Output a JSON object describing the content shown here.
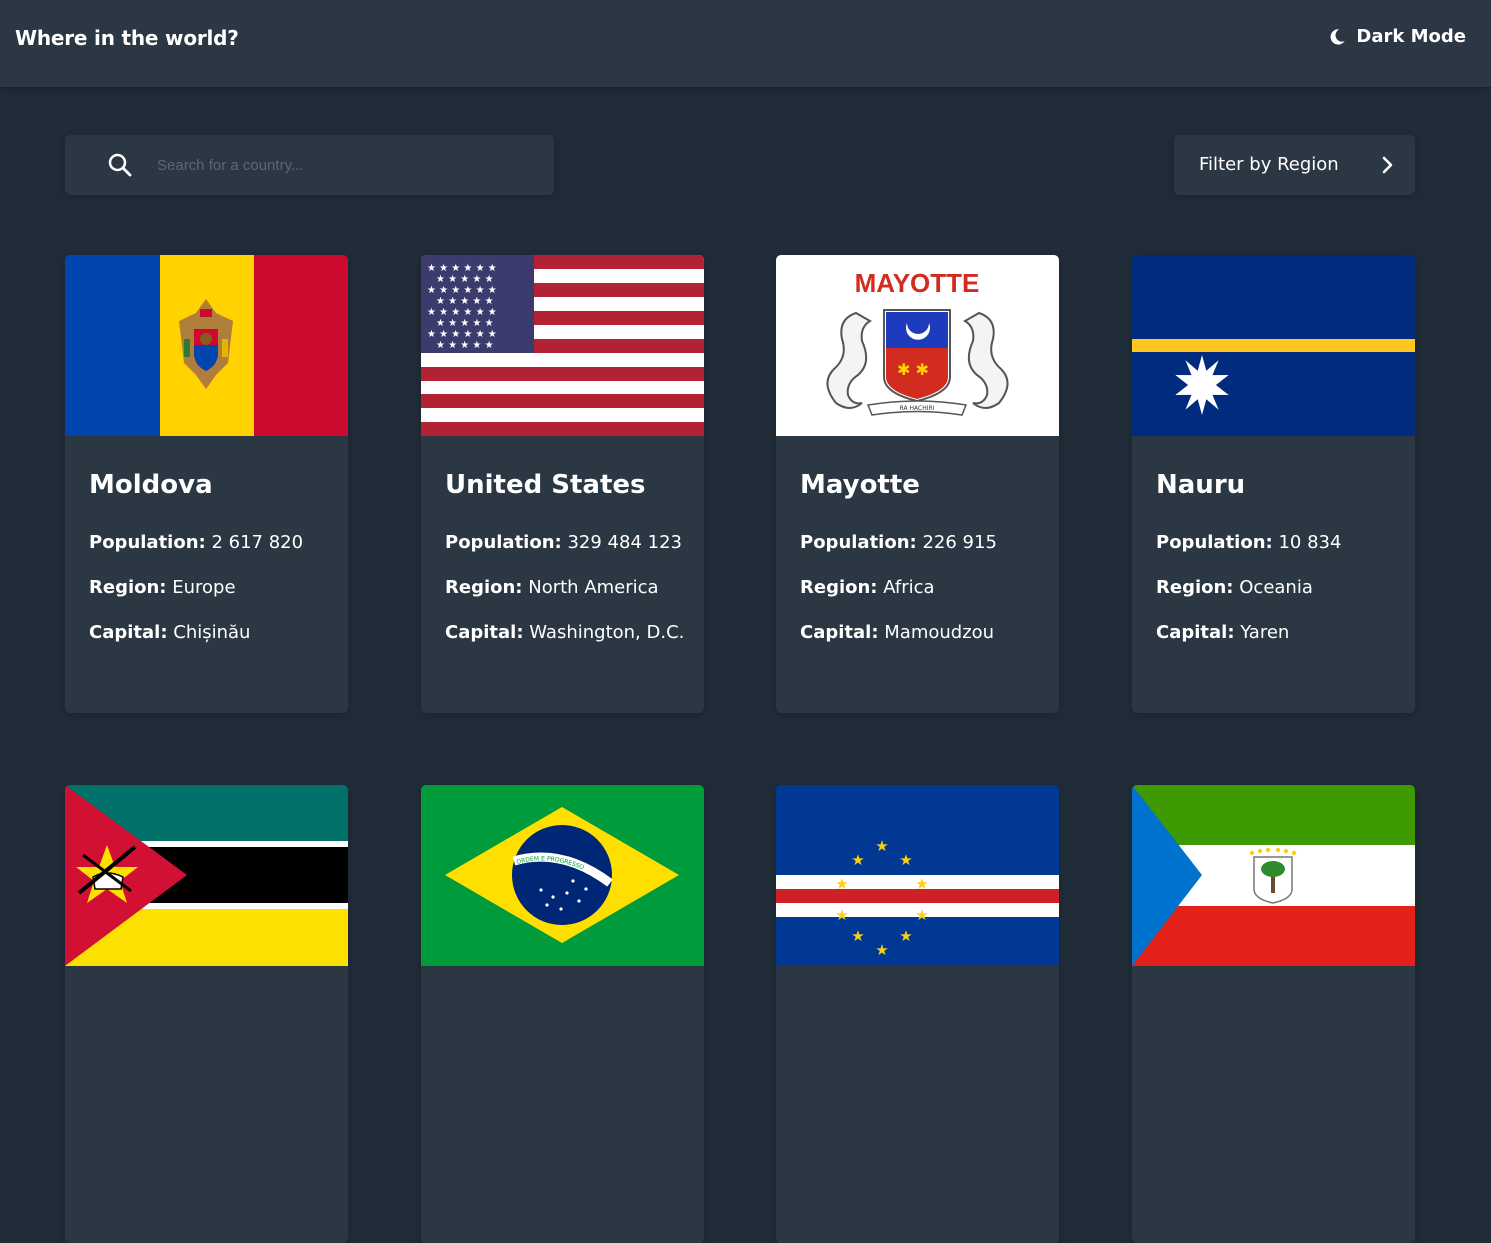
{
  "header": {
    "title": "Where in the world?",
    "theme_toggle_label": "Dark Mode"
  },
  "search": {
    "placeholder": "Search for a country...",
    "value": ""
  },
  "filter": {
    "label": "Filter by Region"
  },
  "labels": {
    "population": "Population:",
    "region": "Region:",
    "capital": "Capital:"
  },
  "flag_text": {
    "mayotte_title": "MAYOTTE",
    "mayotte_motto": "RA HACHIRI",
    "brazil_motto": "ORDEM E PROGRESSO"
  },
  "countries": [
    {
      "name": "Moldova",
      "population": "2 617 820",
      "region": "Europe",
      "capital": "Chișinău",
      "flag_icon": "moldova-flag"
    },
    {
      "name": "United States",
      "population": "329 484 123",
      "region": "North America",
      "capital": "Washington, D.C.",
      "flag_icon": "united-states-flag"
    },
    {
      "name": "Mayotte",
      "population": "226 915",
      "region": "Africa",
      "capital": "Mamoudzou",
      "flag_icon": "mayotte-flag"
    },
    {
      "name": "Nauru",
      "population": "10 834",
      "region": "Oceania",
      "capital": "Yaren",
      "flag_icon": "nauru-flag"
    },
    {
      "flag_icon": "mozambique-flag"
    },
    {
      "flag_icon": "brazil-flag"
    },
    {
      "flag_icon": "cape-verde-flag"
    },
    {
      "flag_icon": "equatorial-guinea-flag"
    }
  ]
}
